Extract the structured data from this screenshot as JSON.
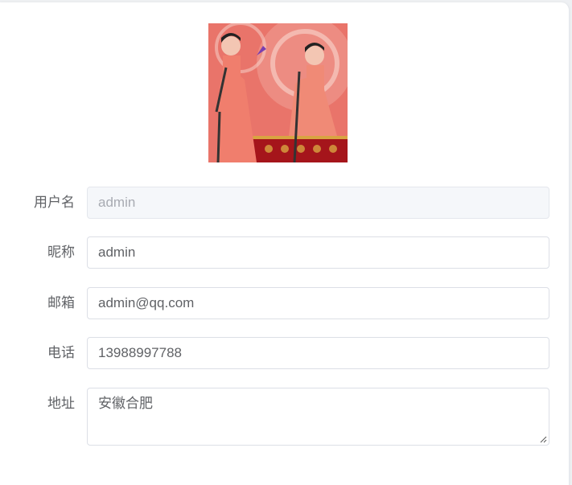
{
  "avatar": {
    "alt": "avatar"
  },
  "form": {
    "username": {
      "label": "用户名",
      "value": "admin"
    },
    "nickname": {
      "label": "昵称",
      "value": "admin"
    },
    "email": {
      "label": "邮箱",
      "value": "admin@qq.com"
    },
    "phone": {
      "label": "电话",
      "value": "13988997788"
    },
    "address": {
      "label": "地址",
      "value": "安徽合肥"
    }
  }
}
